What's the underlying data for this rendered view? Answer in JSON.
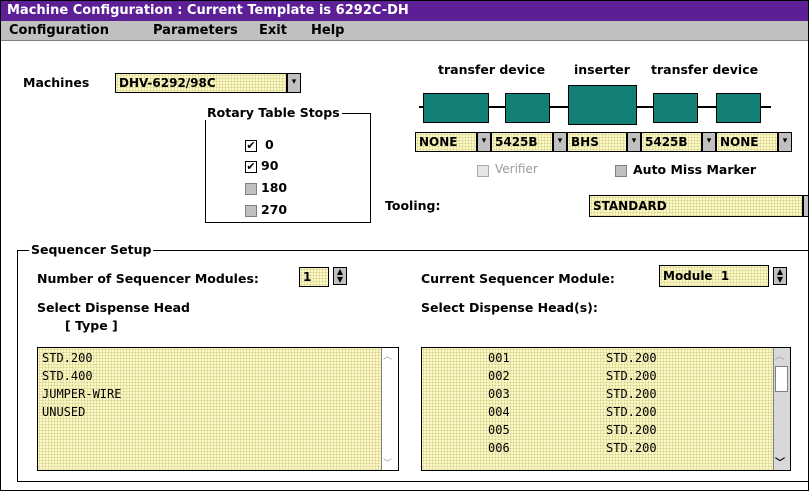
{
  "window": {
    "title": "Machine Configuration : Current Template is 6292C-DH"
  },
  "menu": [
    {
      "label": "Configuration"
    },
    {
      "label": "Parameters"
    },
    {
      "label": "Exit"
    },
    {
      "label": "Help"
    }
  ],
  "machines": {
    "label": "Machines",
    "value": "DHV-6292/98C"
  },
  "rotary_table": {
    "title": "Rotary Table Stops",
    "stops": [
      {
        "label": "0",
        "checked": true
      },
      {
        "label": "90",
        "checked": true
      },
      {
        "label": "180",
        "checked": false
      },
      {
        "label": "270",
        "checked": false
      }
    ]
  },
  "diagram": {
    "headers": [
      "transfer device",
      "inserter",
      "transfer device"
    ],
    "devices": [
      "NONE",
      "5425B",
      "BHS",
      "5425B",
      "NONE"
    ]
  },
  "verifier": {
    "label": "Verifier",
    "enabled": false
  },
  "auto_miss_marker": {
    "label": "Auto Miss Marker",
    "checked": false
  },
  "tooling": {
    "label": "Tooling:",
    "value": "STANDARD"
  },
  "sequencer": {
    "title": "Sequencer Setup",
    "num_modules_label": "Number of Sequencer Modules:",
    "num_modules_value": "1",
    "current_module_label": "Current Sequencer Module:",
    "current_module_value": "Module  1",
    "select_head_label": "Select Dispense Head",
    "type_label": "[ Type ]",
    "select_heads_label": "Select Dispense Head(s):",
    "head_types": [
      "STD.200",
      "STD.400",
      "JUMPER-WIRE",
      "UNUSED"
    ],
    "heads": [
      {
        "num": "001",
        "type": "STD.200"
      },
      {
        "num": "002",
        "type": "STD.200"
      },
      {
        "num": "003",
        "type": "STD.200"
      },
      {
        "num": "004",
        "type": "STD.200"
      },
      {
        "num": "005",
        "type": "STD.200"
      },
      {
        "num": "006",
        "type": "STD.200"
      }
    ]
  },
  "colors": {
    "title_bar": "#5c1f96",
    "machine_block": "#128074",
    "field_bg": "#fbf8c8"
  }
}
